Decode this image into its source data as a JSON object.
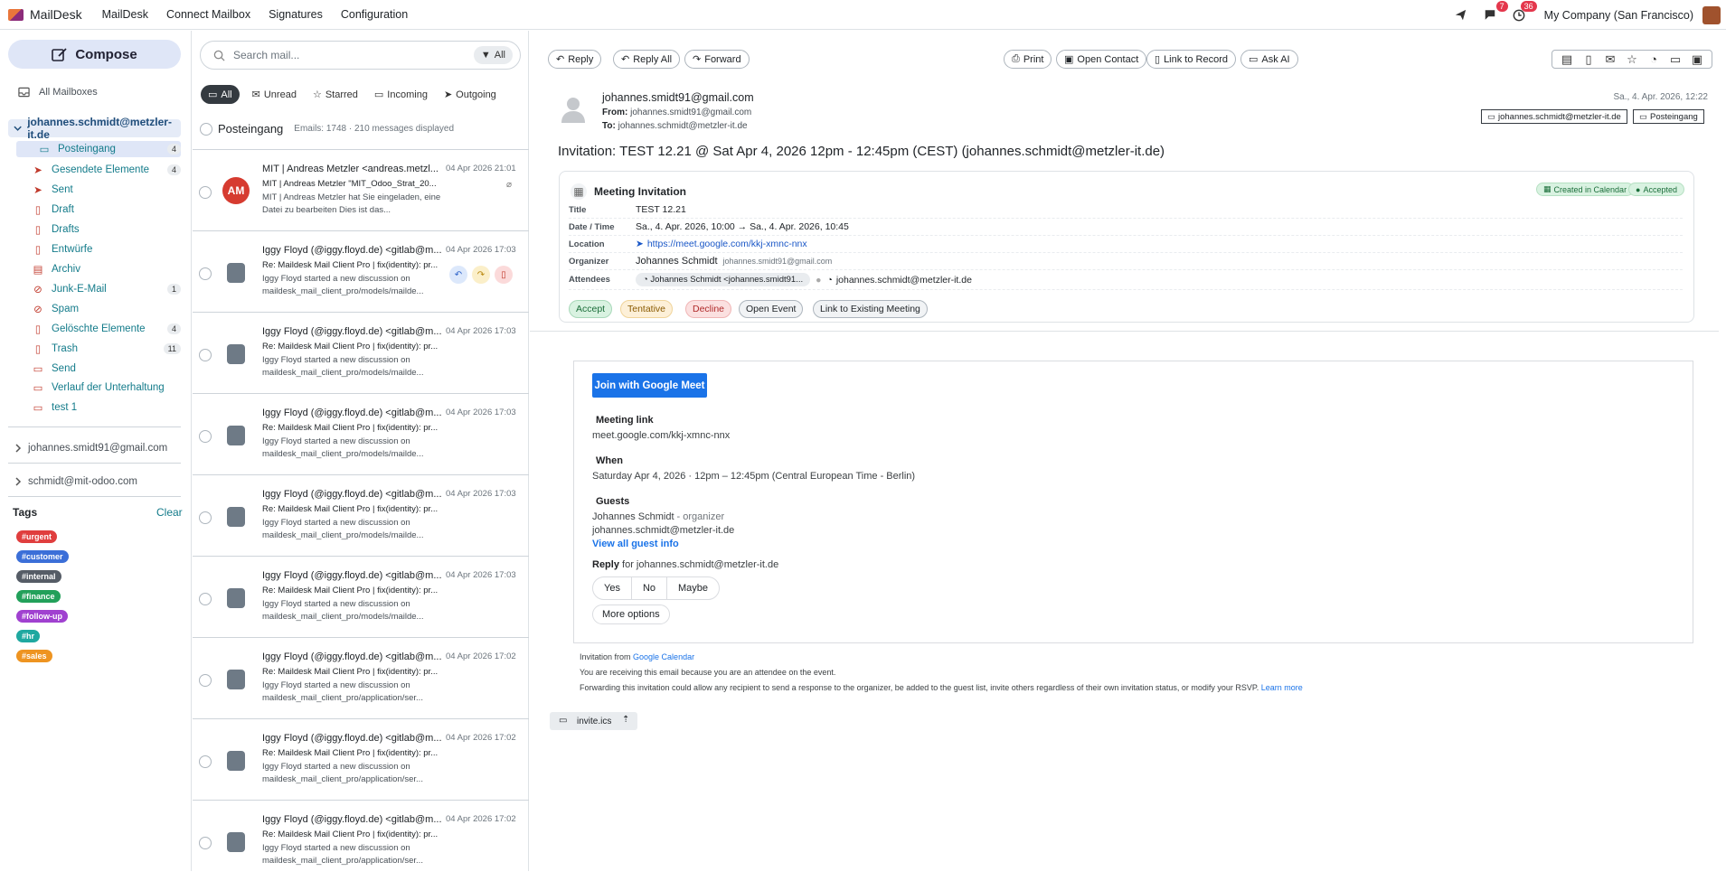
{
  "app": {
    "name": "MailDesk"
  },
  "menu": [
    "MailDesk",
    "Connect Mailbox",
    "Signatures",
    "Configuration"
  ],
  "topbar": {
    "chat_badge": "7",
    "activity_badge": "36",
    "company": "My Company (San Francisco)"
  },
  "sidebar": {
    "compose": "Compose",
    "all_mailboxes": "All Mailboxes",
    "account": "johannes.schmidt@metzler-it.de",
    "folders": [
      {
        "label": "Posteingang",
        "count": "4"
      },
      {
        "label": "Gesendete Elemente",
        "count": "4"
      },
      {
        "label": "Sent",
        "count": ""
      },
      {
        "label": "Draft",
        "count": ""
      },
      {
        "label": "Drafts",
        "count": ""
      },
      {
        "label": "Entwürfe",
        "count": ""
      },
      {
        "label": "Archiv",
        "count": ""
      },
      {
        "label": "Junk-E-Mail",
        "count": "1"
      },
      {
        "label": "Spam",
        "count": ""
      },
      {
        "label": "Gelöschte Elemente",
        "count": "4"
      },
      {
        "label": "Trash",
        "count": "11"
      },
      {
        "label": "Send",
        "count": ""
      },
      {
        "label": "Verlauf der Unterhaltung",
        "count": ""
      },
      {
        "label": "test 1",
        "count": ""
      }
    ],
    "other_accounts": [
      "johannes.smidt91@gmail.com",
      "schmidt@mit-odoo.com"
    ],
    "tags_title": "Tags",
    "clear": "Clear",
    "tags": [
      {
        "label": "#urgent",
        "color": "#e03e3e"
      },
      {
        "label": "#customer",
        "color": "#3b6fd8"
      },
      {
        "label": "#internal",
        "color": "#555c66"
      },
      {
        "label": "#finance",
        "color": "#22a05a"
      },
      {
        "label": "#follow-up",
        "color": "#a041d0"
      },
      {
        "label": "#hr",
        "color": "#1fa8a0"
      },
      {
        "label": "#sales",
        "color": "#ee9421"
      }
    ]
  },
  "list": {
    "search_placeholder": "Search mail...",
    "search_filter": "All",
    "filters": [
      "All",
      "Unread",
      "Starred",
      "Incoming",
      "Outgoing"
    ],
    "folder_title": "Posteingang",
    "counts": "Emails: 1748 · 210 messages displayed",
    "emails": [
      {
        "initials": "AM",
        "from": "MIT | Andreas Metzler <andreas.metzl...",
        "date": "04 Apr 2026 21:01",
        "subject": "MIT | Andreas Metzler \"MIT_Odoo_Strat_20...",
        "preview": "MIT | Andreas Metzler hat Sie eingeladen, eine Datei zu bearbeiten Dies ist das..."
      },
      {
        "initials": "",
        "from": "Iggy Floyd (@iggy.floyd.de) <gitlab@m...",
        "date": "04 Apr 2026 17:03",
        "subject": "Re: Maildesk Mail Client Pro | fix(identity): pr...",
        "preview": "Iggy Floyd started a new discussion on maildesk_mail_client_pro/models/mailde..."
      },
      {
        "initials": "",
        "from": "Iggy Floyd (@iggy.floyd.de) <gitlab@m...",
        "date": "04 Apr 2026 17:03",
        "subject": "Re: Maildesk Mail Client Pro | fix(identity): pr...",
        "preview": "Iggy Floyd started a new discussion on maildesk_mail_client_pro/models/mailde..."
      },
      {
        "initials": "",
        "from": "Iggy Floyd (@iggy.floyd.de) <gitlab@m...",
        "date": "04 Apr 2026 17:03",
        "subject": "Re: Maildesk Mail Client Pro | fix(identity): pr...",
        "preview": "Iggy Floyd started a new discussion on maildesk_mail_client_pro/models/mailde..."
      },
      {
        "initials": "",
        "from": "Iggy Floyd (@iggy.floyd.de) <gitlab@m...",
        "date": "04 Apr 2026 17:03",
        "subject": "Re: Maildesk Mail Client Pro | fix(identity): pr...",
        "preview": "Iggy Floyd started a new discussion on maildesk_mail_client_pro/models/mailde..."
      },
      {
        "initials": "",
        "from": "Iggy Floyd (@iggy.floyd.de) <gitlab@m...",
        "date": "04 Apr 2026 17:03",
        "subject": "Re: Maildesk Mail Client Pro | fix(identity): pr...",
        "preview": "Iggy Floyd started a new discussion on maildesk_mail_client_pro/models/mailde..."
      },
      {
        "initials": "",
        "from": "Iggy Floyd (@iggy.floyd.de) <gitlab@m...",
        "date": "04 Apr 2026 17:02",
        "subject": "Re: Maildesk Mail Client Pro | fix(identity): pr...",
        "preview": "Iggy Floyd started a new discussion on maildesk_mail_client_pro/application/ser..."
      },
      {
        "initials": "",
        "from": "Iggy Floyd (@iggy.floyd.de) <gitlab@m...",
        "date": "04 Apr 2026 17:02",
        "subject": "Re: Maildesk Mail Client Pro | fix(identity): pr...",
        "preview": "Iggy Floyd started a new discussion on maildesk_mail_client_pro/application/ser..."
      },
      {
        "initials": "",
        "from": "Iggy Floyd (@iggy.floyd.de) <gitlab@m...",
        "date": "04 Apr 2026 17:02",
        "subject": "Re: Maildesk Mail Client Pro | fix(identity): pr...",
        "preview": "Iggy Floyd started a new discussion on maildesk_mail_client_pro/application/ser..."
      }
    ]
  },
  "reader": {
    "actions": [
      "Reply",
      "Reply All",
      "Forward"
    ],
    "tools": [
      "Print",
      "Open Contact",
      "Link to Record",
      "Ask AI"
    ],
    "from_name": "johannes.smidt91@gmail.com",
    "from_label": "From:",
    "from_addr": "johannes.smidt91@gmail.com",
    "to_label": "To:",
    "to_addr": "johannes.schmidt@metzler-it.de",
    "date": "Sa., 4. Apr. 2026, 12:22",
    "mailbox_pill": "johannes.schmidt@metzler-it.de",
    "folder_pill": "Posteingang",
    "subject": "Invitation: TEST 12.21 @ Sat Apr 4, 2026 12pm - 12:45pm (CEST) (johannes.schmidt@metzler-it.de)",
    "invite": {
      "heading": "Meeting Invitation",
      "badge_calendar": "Created in Calendar",
      "badge_accepted": "Accepted",
      "title_k": "Title",
      "title_v": "TEST 12.21",
      "dt_k": "Date / Time",
      "dt_v": "Sa., 4. Apr. 2026, 10:00 → Sa., 4. Apr. 2026, 10:45",
      "loc_k": "Location",
      "loc_v": "https://meet.google.com/kkj-xmnc-nnx",
      "org_k": "Organizer",
      "org_name": "Johannes Schmidt",
      "org_email": "johannes.smidt91@gmail.com",
      "att_k": "Attendees",
      "att_1": "Johannes Schmidt <johannes.smidt91...",
      "att_2": "johannes.schmidt@metzler-it.de",
      "buttons": [
        "Accept",
        "Tentative",
        "Decline",
        "Open Event",
        "Link to Existing Meeting"
      ]
    },
    "gcal": {
      "join": "Join with Google Meet",
      "link_h": "Meeting link",
      "link_v": "meet.google.com/kkj-xmnc-nnx",
      "when_h": "When",
      "when_v": "Saturday Apr 4, 2026 · 12pm – 12:45pm (Central European Time - Berlin)",
      "guests_h": "Guests",
      "guest_1": "Johannes Schmidt",
      "guest_1_role": " - organizer",
      "guest_2": "johannes.schmidt@metzler-it.de",
      "view_all": "View all guest info",
      "reply_h": "Reply",
      "reply_for": " for johannes.schmidt@metzler-it.de",
      "yes": "Yes",
      "no": "No",
      "maybe": "Maybe",
      "more": "More options"
    },
    "footer": {
      "from_txt": "Invitation from ",
      "from_link": "Google Calendar",
      "line2": "You are receiving this email because you are an attendee on the event.",
      "line3": "Forwarding this invitation could allow any recipient to send a response to the organizer, be added to the guest list, invite others regardless of their own invitation status, or modify your RSVP. ",
      "learn": "Learn more"
    },
    "attachment": "invite.ics"
  }
}
